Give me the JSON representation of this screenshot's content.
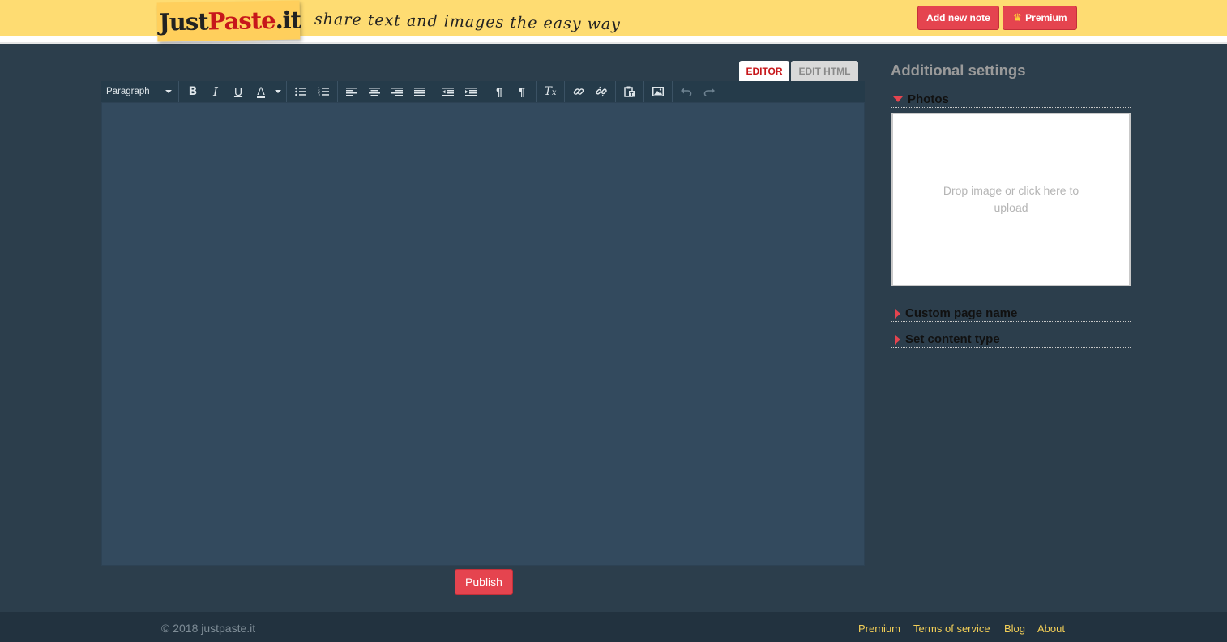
{
  "header": {
    "logo_just": "Just",
    "logo_paste": "Paste",
    "logo_it": ".it",
    "tagline": "share text and images the easy way",
    "add_note_label": "Add new note",
    "premium_label": "Premium",
    "premium_icon": "crown-icon"
  },
  "editor": {
    "tabs": [
      {
        "label": "EDITOR",
        "active": true
      },
      {
        "label": "EDIT HTML",
        "active": false
      }
    ],
    "format_select": "Paragraph",
    "toolbar_icons": [
      "bold",
      "italic",
      "underline",
      "text-color",
      "bullet-list",
      "numbered-list",
      "align-left",
      "align-center",
      "align-right",
      "align-justify",
      "outdent",
      "indent",
      "ltr",
      "rtl",
      "clear-formatting",
      "link",
      "unlink",
      "paste-as-text",
      "insert-image",
      "undo",
      "redo"
    ],
    "publish_label": "Publish"
  },
  "sidebar": {
    "title": "Additional settings",
    "photos_label": "Photos",
    "upload_placeholder": "Drop image or click here to upload",
    "custom_page_label": "Custom page name",
    "content_type_label": "Set content type"
  },
  "footer": {
    "copyright": "© 2018 justpaste.it",
    "links": [
      "Premium",
      "Terms of service",
      "Blog",
      "About"
    ]
  },
  "colors": {
    "header_bg": "#fedc72",
    "page_bg": "#2c3e4c",
    "accent": "#e5444f",
    "editor_bg": "#334a5e",
    "footer_link": "#f3cf57"
  }
}
